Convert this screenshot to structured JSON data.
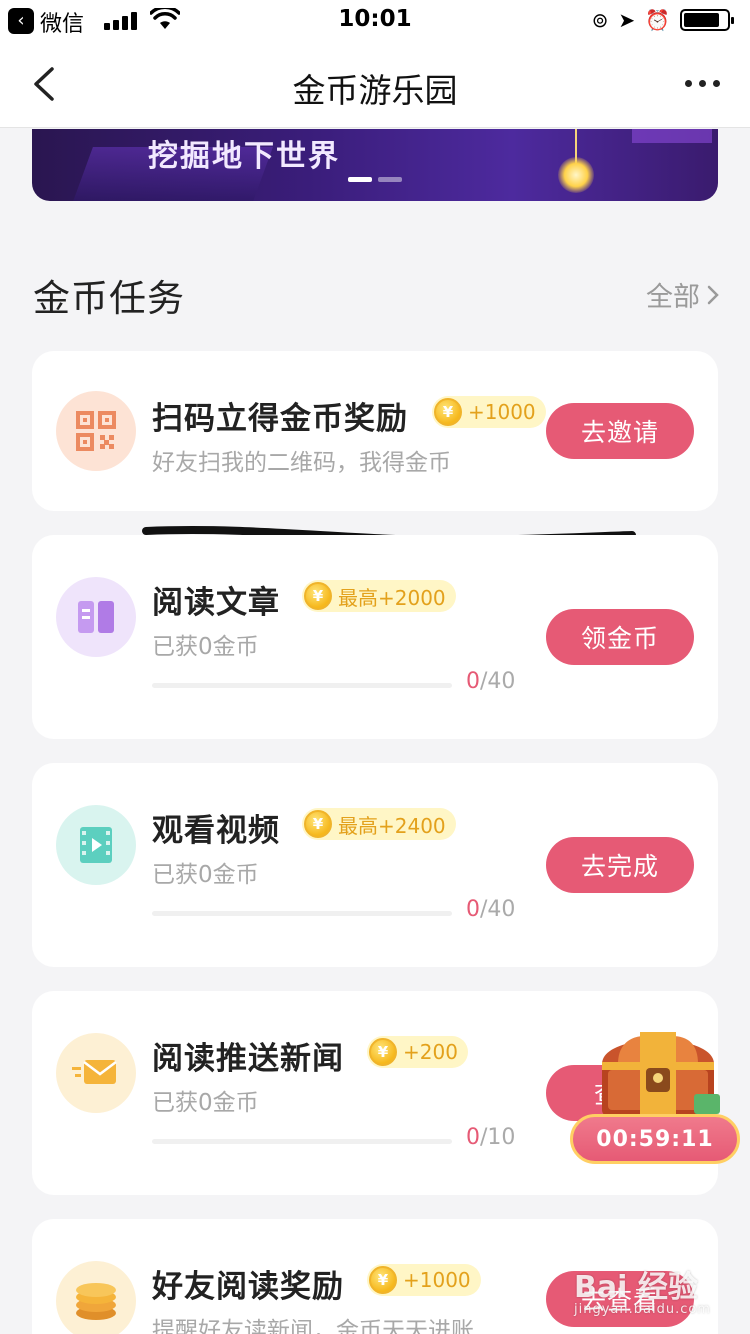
{
  "status_bar": {
    "app_name": "微信",
    "time": "10:01",
    "battery_level": 0.85
  },
  "nav": {
    "title": "金币游乐园",
    "back_icon": "chevron-left-icon",
    "more_icon": "ellipsis-icon"
  },
  "banner": {
    "text": "挖掘地下世界",
    "active_dot": 0,
    "dot_count": 2
  },
  "section": {
    "title": "金币任务",
    "all_label": "全部"
  },
  "tasks": [
    {
      "name": "扫码立得金币奖励",
      "reward": "+1000",
      "subtitle": "好友扫我的二维码，我得金币",
      "button": "去邀请",
      "icon": "qrcode-icon",
      "icon_bg": "#fde3d5",
      "icon_color": "#ec8a60"
    },
    {
      "name": "阅读文章",
      "reward": "最高+2000",
      "subtitle": "已获0金币",
      "button": "领金币",
      "icon": "book-icon",
      "icon_bg": "#efe4fb",
      "icon_color": "#b07be6",
      "progress_current": "0",
      "progress_total": "/40",
      "progress": 0
    },
    {
      "name": "观看视频",
      "reward": "最高+2400",
      "subtitle": "已获0金币",
      "button": "去完成",
      "icon": "video-icon",
      "icon_bg": "#d9f4ef",
      "icon_color": "#5ccfbf",
      "progress_current": "0",
      "progress_total": "/40",
      "progress": 0
    },
    {
      "name": "阅读推送新闻",
      "reward": "+200",
      "subtitle": "已获0金币",
      "button": "查看",
      "icon": "mail-icon",
      "icon_bg": "#fdf0d4",
      "icon_color": "#f5b43a",
      "progress_current": "0",
      "progress_total": "/10",
      "progress": 0
    },
    {
      "name": "好友阅读奖励",
      "reward": "+1000",
      "subtitle": "提醒好友读新闻，金币天天进账",
      "button": "去查看",
      "icon": "coin-stack-icon",
      "icon_bg": "#fdf0d4",
      "icon_color": "#f0a63a"
    }
  ],
  "treasure": {
    "timer": "00:59:11"
  },
  "watermark": {
    "text": "Bai 经验",
    "sub": "jingyan.baidu.com"
  },
  "colors": {
    "accent": "#e65a75",
    "badge_bg": "#fff6c6",
    "badge_text": "#e3a11c"
  }
}
